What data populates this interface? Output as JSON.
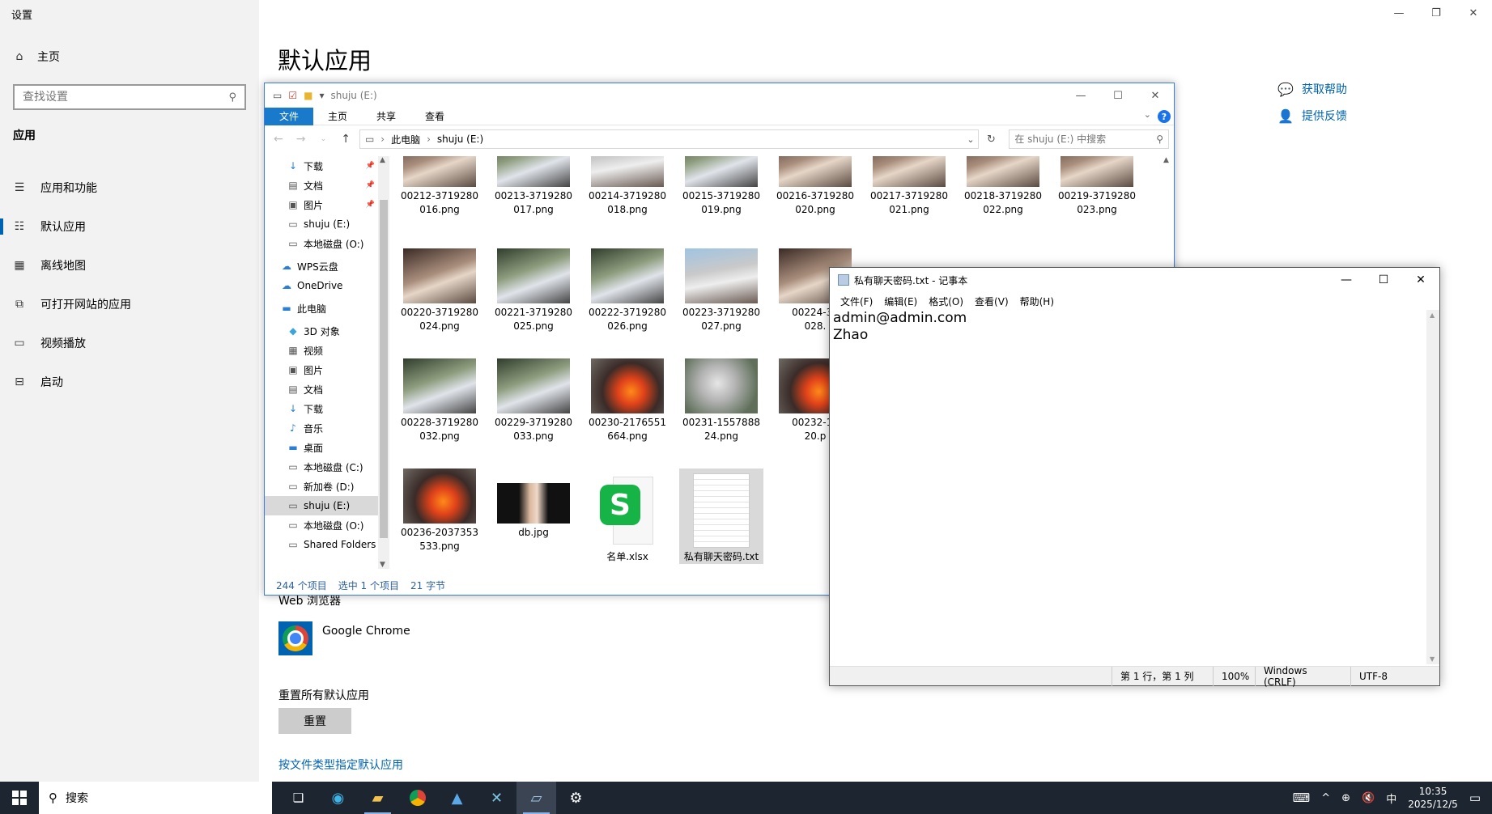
{
  "settings": {
    "title": "设置",
    "home": "主页",
    "search_placeholder": "查找设置",
    "section": "应用",
    "nav": [
      "应用和功能",
      "默认应用",
      "离线地图",
      "可打开网站的应用",
      "视频播放",
      "启动"
    ],
    "heading": "默认应用",
    "help": [
      "获取帮助",
      "提供反馈"
    ],
    "web_browser_label": "Web 浏览器",
    "web_browser_name": "Google Chrome",
    "reset_label": "重置所有默认应用",
    "reset_button": "重置",
    "filetype_link": "按文件类型指定默认应用"
  },
  "explorer": {
    "title": "shuju (E:)",
    "tabs": [
      "文件",
      "主页",
      "共享",
      "查看"
    ],
    "path": [
      "此电脑",
      "shuju (E:)"
    ],
    "search_placeholder": "在 shuju (E:) 中搜索",
    "nav": [
      {
        "label": "下载",
        "icon": "download-icon",
        "pinned": true
      },
      {
        "label": "文档",
        "icon": "document-icon",
        "pinned": true
      },
      {
        "label": "图片",
        "icon": "picture-icon",
        "pinned": true
      },
      {
        "label": "shuju (E:)",
        "icon": "drive-icon"
      },
      {
        "label": "本地磁盘 (O:)",
        "icon": "drive-icon"
      },
      {
        "label": "WPS云盘",
        "icon": "cloud-icon"
      },
      {
        "label": "OneDrive",
        "icon": "cloud-icon"
      },
      {
        "label": "此电脑",
        "icon": "computer-icon"
      },
      {
        "label": "3D 对象",
        "icon": "cube-icon"
      },
      {
        "label": "视频",
        "icon": "video-icon"
      },
      {
        "label": "图片",
        "icon": "picture-icon"
      },
      {
        "label": "文档",
        "icon": "document-icon"
      },
      {
        "label": "下载",
        "icon": "download-icon"
      },
      {
        "label": "音乐",
        "icon": "music-icon"
      },
      {
        "label": "桌面",
        "icon": "desktop-icon"
      },
      {
        "label": "本地磁盘 (C:)",
        "icon": "drive-icon"
      },
      {
        "label": "新加卷 (D:)",
        "icon": "drive-icon"
      },
      {
        "label": "shuju (E:)",
        "icon": "drive-icon",
        "selected": true
      },
      {
        "label": "本地磁盘 (O:)",
        "icon": "drive-icon"
      },
      {
        "label": "Shared Folders",
        "icon": "drive-icon"
      }
    ],
    "files": [
      {
        "name": "00212-3719280016.png",
        "line1": "00212-3719280",
        "line2": "016.png",
        "kind": "a"
      },
      {
        "name": "00213-3719280017.png",
        "line1": "00213-3719280",
        "line2": "017.png",
        "kind": "b"
      },
      {
        "name": "00214-3719280018.png",
        "line1": "00214-3719280",
        "line2": "018.png",
        "kind": "c"
      },
      {
        "name": "00215-3719280019.png",
        "line1": "00215-3719280",
        "line2": "019.png",
        "kind": "b"
      },
      {
        "name": "00216-3719280020.png",
        "line1": "00216-3719280",
        "line2": "020.png",
        "kind": "a"
      },
      {
        "name": "00217-3719280021.png",
        "line1": "00217-3719280",
        "line2": "021.png",
        "kind": "a"
      },
      {
        "name": "00218-3719280022.png",
        "line1": "00218-3719280",
        "line2": "022.png",
        "kind": "a"
      },
      {
        "name": "00219-3719280023.png",
        "line1": "00219-3719280",
        "line2": "023.png",
        "kind": "a"
      },
      {
        "name": "00220-3719280024.png",
        "line1": "00220-3719280",
        "line2": "024.png",
        "kind": "a"
      },
      {
        "name": "00221-3719280025.png",
        "line1": "00221-3719280",
        "line2": "025.png",
        "kind": "b"
      },
      {
        "name": "00222-3719280026.png",
        "line1": "00222-3719280",
        "line2": "026.png",
        "kind": "b"
      },
      {
        "name": "00223-3719280027.png",
        "line1": "00223-3719280",
        "line2": "027.png",
        "kind": "c"
      },
      {
        "name": "00224-3719280028.png",
        "line1": "00224-37",
        "line2": "028.",
        "kind": "a"
      },
      {
        "name": "00228-3719280032.png",
        "line1": "00228-3719280",
        "line2": "032.png",
        "kind": "b"
      },
      {
        "name": "00229-3719280033.png",
        "line1": "00229-3719280",
        "line2": "033.png",
        "kind": "b"
      },
      {
        "name": "00230-2176551664.png",
        "line1": "00230-2176551",
        "line2": "664.png",
        "kind": "fire"
      },
      {
        "name": "00231-155788824.png",
        "line1": "00231-1557888",
        "line2": "24.png",
        "kind": "smoke"
      },
      {
        "name": "00232-1020.png",
        "line1": "00232-10",
        "line2": "20.p",
        "kind": "fire"
      },
      {
        "name": "00236-2037353533.png",
        "line1": "00236-2037353",
        "line2": "533.png",
        "kind": "fire"
      },
      {
        "name": "db.jpg",
        "line1": "db.jpg",
        "line2": "",
        "kind": "db"
      },
      {
        "name": "名单.xlsx",
        "line1": "名单.xlsx",
        "line2": "",
        "kind": "xlsx"
      },
      {
        "name": "私有聊天密码.txt",
        "line1": "私有聊天密码.txt",
        "line2": "",
        "kind": "txt",
        "selected": true
      }
    ],
    "status": [
      "244 个项目",
      "选中 1 个项目",
      "21 字节"
    ]
  },
  "notepad": {
    "title": "私有聊天密码.txt - 记事本",
    "menu": [
      "文件(F)",
      "编辑(E)",
      "格式(O)",
      "查看(V)",
      "帮助(H)"
    ],
    "content": "admin@admin.com\nZhao",
    "status": [
      "第 1 行，第 1 列",
      "100%",
      "Windows (CRLF)",
      "UTF-8"
    ]
  },
  "taskbar": {
    "search": "搜索",
    "ime": "中",
    "time": "10:35",
    "date": "2025/12/5"
  }
}
